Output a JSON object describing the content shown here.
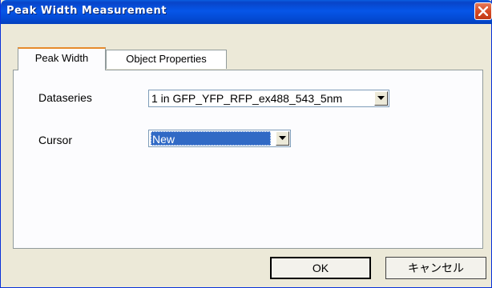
{
  "window": {
    "title": "Peak Width Measurement"
  },
  "tabs": [
    {
      "label": "Peak Width",
      "active": true
    },
    {
      "label": "Object Properties",
      "active": false
    }
  ],
  "form": {
    "dataseries_label": "Dataseries",
    "dataseries_value": "1 in GFP_YFP_RFP_ex488_543_5nm",
    "cursor_label": "Cursor",
    "cursor_value": "New"
  },
  "buttons": {
    "ok_label": "OK",
    "cancel_label": "キャンセル"
  },
  "colors": {
    "titlebar": "#0656e8",
    "close_button": "#d64b25",
    "active_tab_accent": "#e68b2c",
    "selection": "#316ac5",
    "dialog_face": "#ece9d8"
  }
}
